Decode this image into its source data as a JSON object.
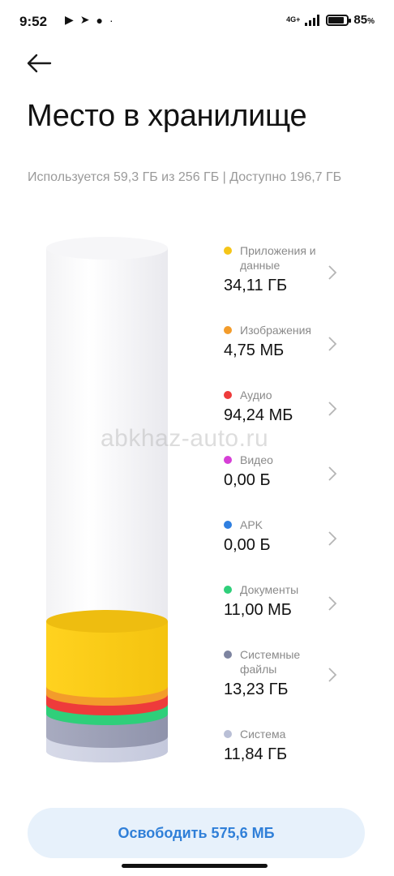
{
  "status_bar": {
    "time": "9:52",
    "network": "4G+",
    "battery_percent": "85",
    "battery_unit": "%"
  },
  "header": {
    "title": "Место в хранилище"
  },
  "summary": "Используется 59,3 ГБ из 256 ГБ | Доступно 196,7 ГБ",
  "categories": [
    {
      "label": "Приложения и данные",
      "value": "34,11 ГБ",
      "color": "#f5c518",
      "has_chevron": true
    },
    {
      "label": "Изображения",
      "value": "4,75 МБ",
      "color": "#f39c2b",
      "has_chevron": true
    },
    {
      "label": "Аудио",
      "value": "94,24 МБ",
      "color": "#ee3b3b",
      "has_chevron": true
    },
    {
      "label": "Видео",
      "value": "0,00 Б",
      "color": "#d63fd6",
      "has_chevron": true
    },
    {
      "label": "APK",
      "value": "0,00 Б",
      "color": "#2f7fe0",
      "has_chevron": true
    },
    {
      "label": "Документы",
      "value": "11,00 МБ",
      "color": "#2fcf7a",
      "has_chevron": true
    },
    {
      "label": "Системные файлы",
      "value": "13,23 ГБ",
      "color": "#7d84a0",
      "has_chevron": true
    },
    {
      "label": "Система",
      "value": "11,84 ГБ",
      "color": "#b9bfd6",
      "has_chevron": false
    }
  ],
  "watermark": "abkhaz-auto.ru",
  "free_button": {
    "label": "Освободить 575,6 МБ"
  },
  "icons": {
    "back": "arrow-left-icon",
    "chevron": "chevron-right-icon"
  }
}
